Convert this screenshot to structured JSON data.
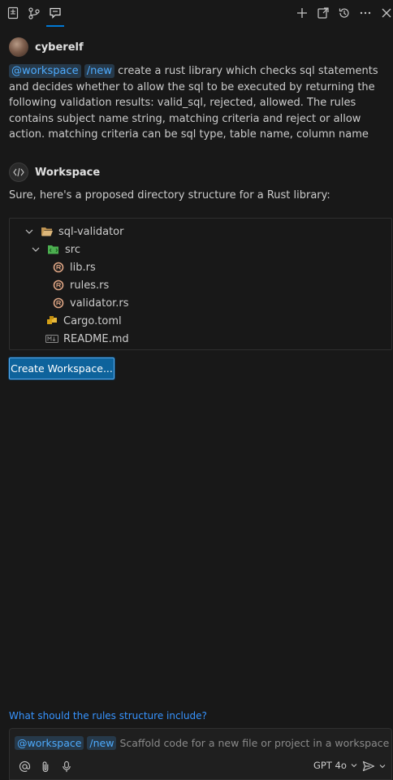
{
  "user": {
    "name": "cyberelf"
  },
  "prompt": {
    "agent_chip": "@workspace",
    "command_chip": "/new",
    "text": "create a rust library which checks sql statements and decides whether to allow the sql to be executed by returning the following validation results: valid_sql, rejected, allowed. The rules contains subject name string, matching criteria and reject or allow action. matching criteria can be sql type, table name, column name"
  },
  "response": {
    "agent_name": "Workspace",
    "message": "Sure, here's a proposed directory structure for a Rust library:",
    "tree": {
      "root": "sql-validator",
      "src_folder": "src",
      "files": [
        "lib.rs",
        "rules.rs",
        "validator.rs"
      ],
      "cargo": "Cargo.toml",
      "readme": "README.md"
    },
    "create_button": "Create Workspace..."
  },
  "followup": "What should the rules structure include?",
  "input": {
    "agent_chip": "@workspace",
    "command_chip": "/new",
    "placeholder": "Scaffold code for a new file or project in a workspace",
    "model": "GPT 4o"
  },
  "colors": {
    "accent": "#0078d4",
    "link": "#3794ff",
    "chip_text": "#4daafc",
    "button": "#0e639c"
  }
}
